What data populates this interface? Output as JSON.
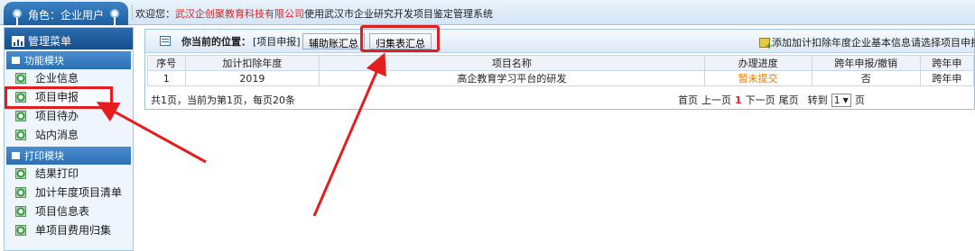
{
  "topbar": {
    "role_label": "角色：企业用户",
    "welcome_prefix": "欢迎您：",
    "company": "武汉企创聚教育科技有限公司",
    "welcome_suffix": "使用武汉市企业研究开发项目鉴定管理系统"
  },
  "sidebar": {
    "title": "管理菜单",
    "sections": [
      {
        "label": "功能模块",
        "items": [
          {
            "label": "企业信息",
            "icon": "bullet-icon"
          },
          {
            "label": "项目申报",
            "icon": "bullet-icon",
            "selected": true
          },
          {
            "label": "项目待办",
            "icon": "bullet-icon"
          },
          {
            "label": "站内消息",
            "icon": "bullet-icon"
          }
        ]
      },
      {
        "label": "打印模块",
        "items": [
          {
            "label": "结果打印",
            "icon": "bullet-icon"
          },
          {
            "label": "加计年度项目清单",
            "icon": "bullet-icon"
          },
          {
            "label": "项目信息表",
            "icon": "bullet-icon"
          },
          {
            "label": "单项目费用归集",
            "icon": "bullet-icon"
          }
        ]
      }
    ]
  },
  "location": {
    "label": "你当前的位置：",
    "value": "[项目申报]"
  },
  "toolbar": {
    "aux_button": "辅助账汇总",
    "summary_button": "归集表汇总",
    "add_link": "添加加计扣除年度企业基本信息",
    "choose_link": "请选择项目申报"
  },
  "table": {
    "headers": [
      "序号",
      "加计扣除年度",
      "项目名称",
      "办理进度",
      "跨年申报/撤销",
      "跨年申"
    ],
    "rows": [
      [
        "1",
        "2019",
        "高企教育学习平台的研发",
        "暂未提交",
        "否",
        "跨年申"
      ]
    ]
  },
  "pager": {
    "summary": "共1页，当前为第1页，每页20条",
    "first": "首页",
    "prev": "上一页",
    "current": "1",
    "next": "下一页",
    "last": "尾页",
    "goto_prefix": "转到",
    "goto_value": "1",
    "goto_suffix": "页"
  },
  "colors": {
    "highlight": "#e41e1e",
    "status_pending": "#e07a00",
    "sidebar_header": "#174f8c"
  }
}
